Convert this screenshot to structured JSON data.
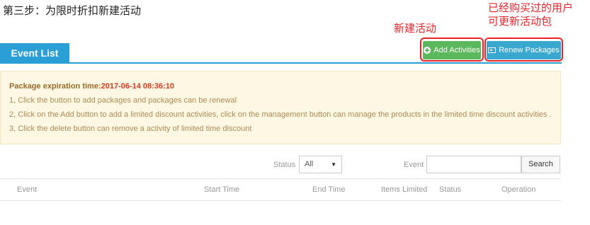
{
  "step_title": "第三步：为限时折扣新建活动",
  "annotations": {
    "new_activity": "新建活动",
    "renew_line1": "已经购买过的用户",
    "renew_line2": "可更新活动包"
  },
  "tabs": [
    {
      "label": "Event List",
      "active": true
    }
  ],
  "toolbar": {
    "add_label": "Add Activities",
    "renew_label": "Renew Packages"
  },
  "notice": {
    "expiration_label": "Package expiration time:",
    "expiration_value": "2017-06-14 08:36:10",
    "lines": [
      "1, Click the button to add packages and packages can be renewal",
      "2, Click on the Add button to add a limited discount activities, click on the management button can manage the products in the limited time discount activities .",
      "3, Click the delete button can remove a activity of limited time discount"
    ]
  },
  "filters": {
    "status_label": "Status",
    "status_value": "All",
    "event_label": "Event",
    "event_value": "",
    "search_label": "Search"
  },
  "table": {
    "columns": [
      "Event",
      "Start Time",
      "End Time",
      "Items Limited",
      "Status",
      "Operation"
    ]
  },
  "colors": {
    "primary": "#2a9fd6",
    "success": "#5cb85c",
    "info": "#3aa7cf",
    "highlight": "#e8242a",
    "notice_bg": "#fcf8e3",
    "expiration": "#d9381e"
  },
  "icons": {
    "add": "plus-circle-icon",
    "renew": "package-icon",
    "select": "caret-down-icon"
  }
}
